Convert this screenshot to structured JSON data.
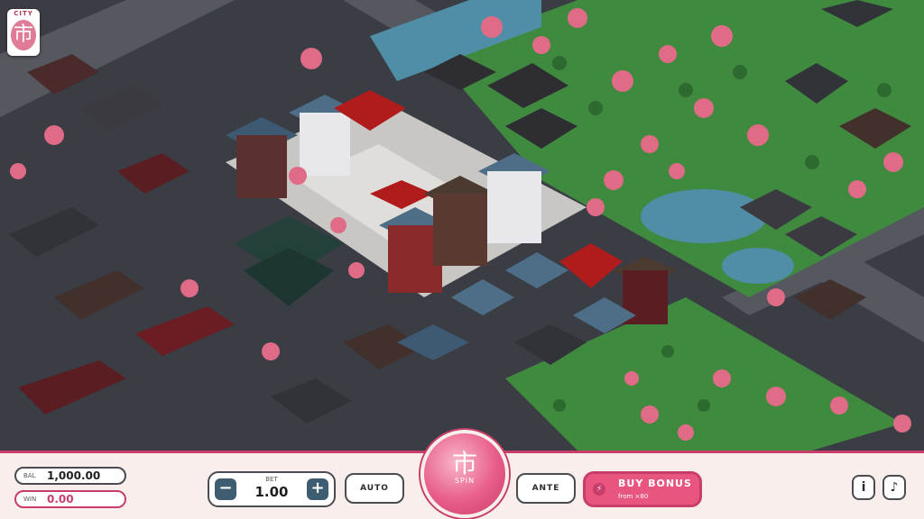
{
  "logo": {
    "top_text": "CITY",
    "mark": "市",
    "icon": "city-kanji-logo"
  },
  "hud": {
    "balance": {
      "label": "BAL",
      "value": "1,000.00"
    },
    "win": {
      "label": "WIN",
      "value": "0.00"
    },
    "bet": {
      "label": "BET",
      "value": "1.00",
      "minus": "−",
      "plus": "+"
    },
    "auto": "AUTO",
    "spin": {
      "mark": "市",
      "label": "SPIN"
    },
    "ante": "ANTE",
    "buy_bonus": {
      "label": "BUY BONUS",
      "sub": "from ×80",
      "icon": "lightning-icon"
    },
    "info": "i",
    "sound": "♪"
  },
  "colors": {
    "accent": "#c93d6a",
    "accent_light": "#e8557f",
    "panel": "#f8efec",
    "ground": "#6a6f78",
    "grass": "#3f8a3f",
    "water": "#4f8ea6",
    "blossom": "#e06b86"
  }
}
